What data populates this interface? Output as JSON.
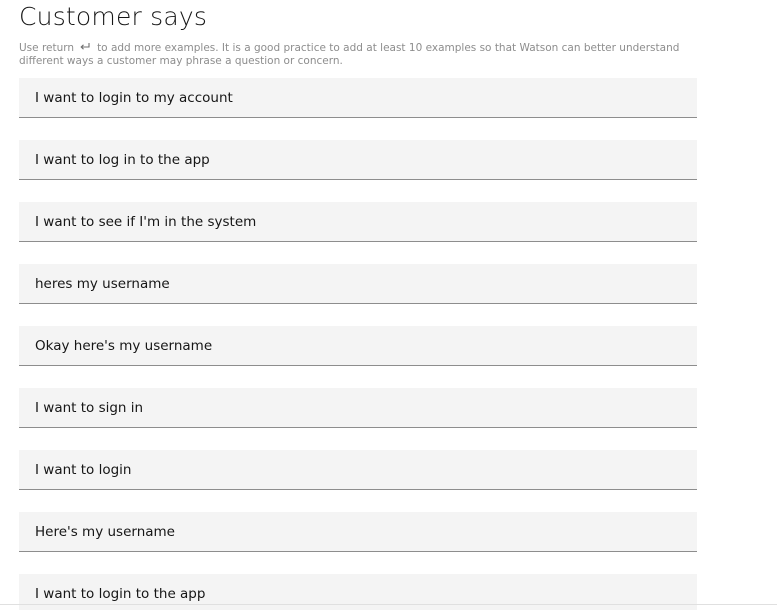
{
  "header": {
    "title": "Customer says",
    "helper_before_icon": "Use return",
    "helper_icon": "return-key-icon",
    "helper_after_icon": "to add more examples. It is a good practice to add at least 10 examples so that Watson can better understand different ways a customer may phrase a question or concern."
  },
  "examples": [
    {
      "value": "I want to login to my account"
    },
    {
      "value": "I want to log in to the app"
    },
    {
      "value": "I want to see if I'm in the system"
    },
    {
      "value": "heres my username"
    },
    {
      "value": "Okay here's my username"
    },
    {
      "value": "I want to sign in"
    },
    {
      "value": "I want to login"
    },
    {
      "value": "Here's my username"
    },
    {
      "value": "I want to login to the app"
    }
  ]
}
